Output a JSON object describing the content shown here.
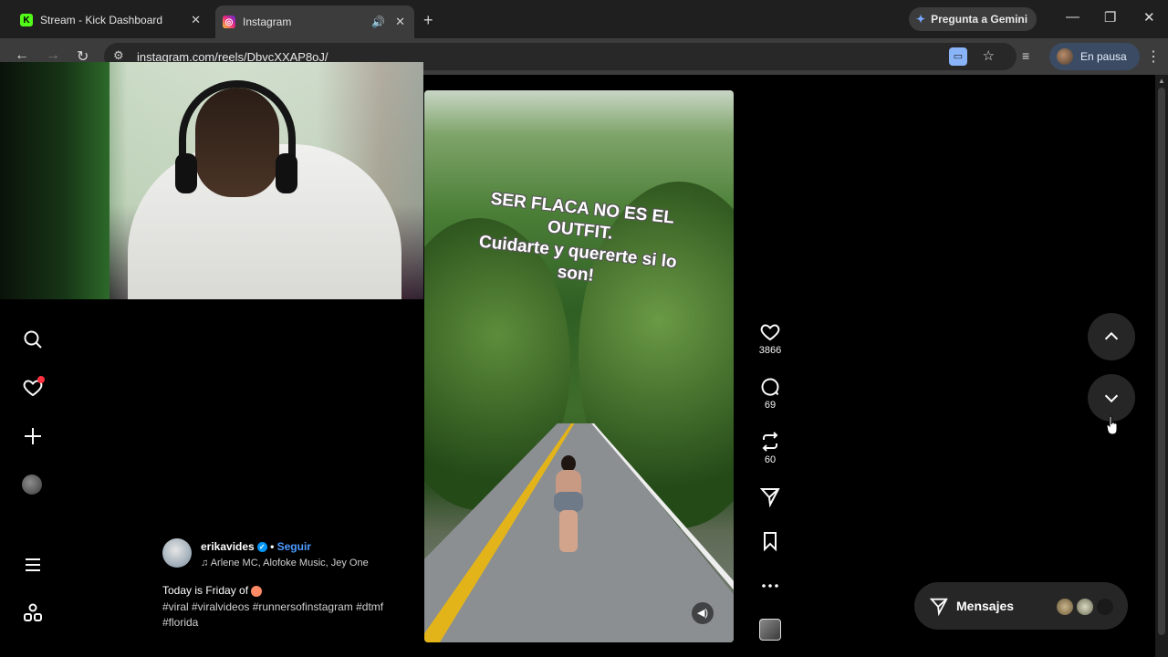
{
  "browser": {
    "tabs": [
      {
        "title": "Stream - Kick Dashboard",
        "favicon": "kick-icon",
        "active": false
      },
      {
        "title": "Instagram",
        "favicon": "instagram-icon",
        "active": true,
        "audio": true
      }
    ],
    "gemini_label": "Pregunta a Gemini",
    "url": "instagram.com/reels/DbvcXXAP8oJ/",
    "profile_label": "En pausa"
  },
  "reel": {
    "caption_line1": "SER FLACA NO ES EL",
    "caption_line2": "OUTFIT.",
    "caption_line3": "Cuidarte y quererte si lo",
    "caption_line4": "son!"
  },
  "actions": {
    "likes": "3866",
    "comments": "69",
    "reposts": "60"
  },
  "author": {
    "username": "erikavides",
    "separator": "•",
    "follow_label": "Seguir",
    "music": "Arlene MC, Alofoke Music, Jey One",
    "description": "Today is Friday of",
    "hashtags": "#viral #viralvideos #runnersofinstagram #dtmf #florida"
  },
  "messages": {
    "label": "Mensajes"
  },
  "colors": {
    "accent_blue": "#0095f6",
    "follow_link": "#4c9bff",
    "notification_dot": "#ff3040",
    "kick_green": "#53fc18"
  }
}
